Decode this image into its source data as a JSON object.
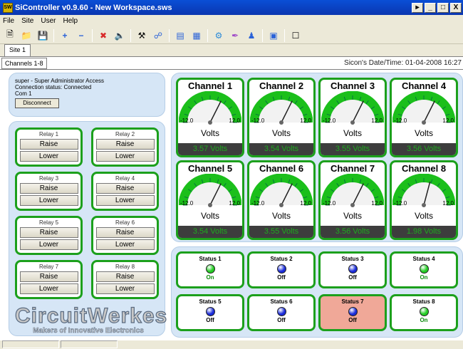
{
  "window": {
    "title": "SiController v0.9.60 - New Workspace.sws",
    "app_icon": "SW"
  },
  "menu": [
    "File",
    "Site",
    "User",
    "Help"
  ],
  "toolbar_icons": [
    "new-file-icon",
    "open-folder-icon",
    "save-icon",
    "add-icon",
    "remove-icon",
    "stop-icon",
    "speaker-icon",
    "tools-icon",
    "network-icon",
    "document-icon",
    "documents-icon",
    "settings-icon",
    "pen-icon",
    "person-icon",
    "image-icon",
    "blank-page-icon"
  ],
  "tabs": {
    "site": "Site 1",
    "channels": "Channels 1-8"
  },
  "datetime": "Sicon's Date/Time: 01-04-2008 16:27",
  "info": {
    "access": "super - Super Administrator Access",
    "connection": "Connection status: Connected",
    "port": "Com 1",
    "disconnect_label": "Disconnect"
  },
  "relays": [
    {
      "label": "Relay 1",
      "raise": "Raise",
      "lower": "Lower"
    },
    {
      "label": "Relay 2",
      "raise": "Raise",
      "lower": "Lower"
    },
    {
      "label": "Relay 3",
      "raise": "Raise",
      "lower": "Lower"
    },
    {
      "label": "Relay 4",
      "raise": "Raise",
      "lower": "Lower"
    },
    {
      "label": "Relay 5",
      "raise": "Raise",
      "lower": "Lower"
    },
    {
      "label": "Relay 6",
      "raise": "Raise",
      "lower": "Lower"
    },
    {
      "label": "Relay 7",
      "raise": "Raise",
      "lower": "Lower"
    },
    {
      "label": "Relay 8",
      "raise": "Raise",
      "lower": "Lower"
    }
  ],
  "logo": {
    "name": "CircuitWerkes",
    "tagline": "Makers of Innovative Electronics"
  },
  "gauge": {
    "min": "-12.0",
    "max": "12.0",
    "min_value": -12,
    "max_value": 12,
    "unit": "Volts"
  },
  "channels": [
    {
      "name": "Channel 1",
      "value": 3.57,
      "reading": "3.57 Volts"
    },
    {
      "name": "Channel 2",
      "value": 3.54,
      "reading": "3.54 Volts"
    },
    {
      "name": "Channel 3",
      "value": 3.55,
      "reading": "3.55 Volts"
    },
    {
      "name": "Channel 4",
      "value": 3.56,
      "reading": "3.56 Volts"
    },
    {
      "name": "Channel 5",
      "value": 3.54,
      "reading": "3.54 Volts"
    },
    {
      "name": "Channel 6",
      "value": 3.55,
      "reading": "3.55 Volts"
    },
    {
      "name": "Channel 7",
      "value": 3.56,
      "reading": "3.56 Volts"
    },
    {
      "name": "Channel 8",
      "value": 1.98,
      "reading": "1.98 Volts"
    }
  ],
  "statuses": [
    {
      "name": "Status 1",
      "state": "On",
      "led_color": "#22cc22",
      "alarm": false
    },
    {
      "name": "Status 2",
      "state": "Off",
      "led_color": "#1a2bd8",
      "alarm": false
    },
    {
      "name": "Status 3",
      "state": "Off",
      "led_color": "#1a2bd8",
      "alarm": false
    },
    {
      "name": "Status 4",
      "state": "On",
      "led_color": "#22cc22",
      "alarm": false
    },
    {
      "name": "Status 5",
      "state": "Off",
      "led_color": "#1a2bd8",
      "alarm": false
    },
    {
      "name": "Status 6",
      "state": "Off",
      "led_color": "#1a2bd8",
      "alarm": false
    },
    {
      "name": "Status 7",
      "state": "Off",
      "led_color": "#1a2bd8",
      "alarm": true
    },
    {
      "name": "Status 8",
      "state": "On",
      "led_color": "#22cc22",
      "alarm": false
    }
  ],
  "colors": {
    "on_text": "#0a8a0a",
    "off_text": "#000000",
    "border_green": "#1ca01c"
  }
}
